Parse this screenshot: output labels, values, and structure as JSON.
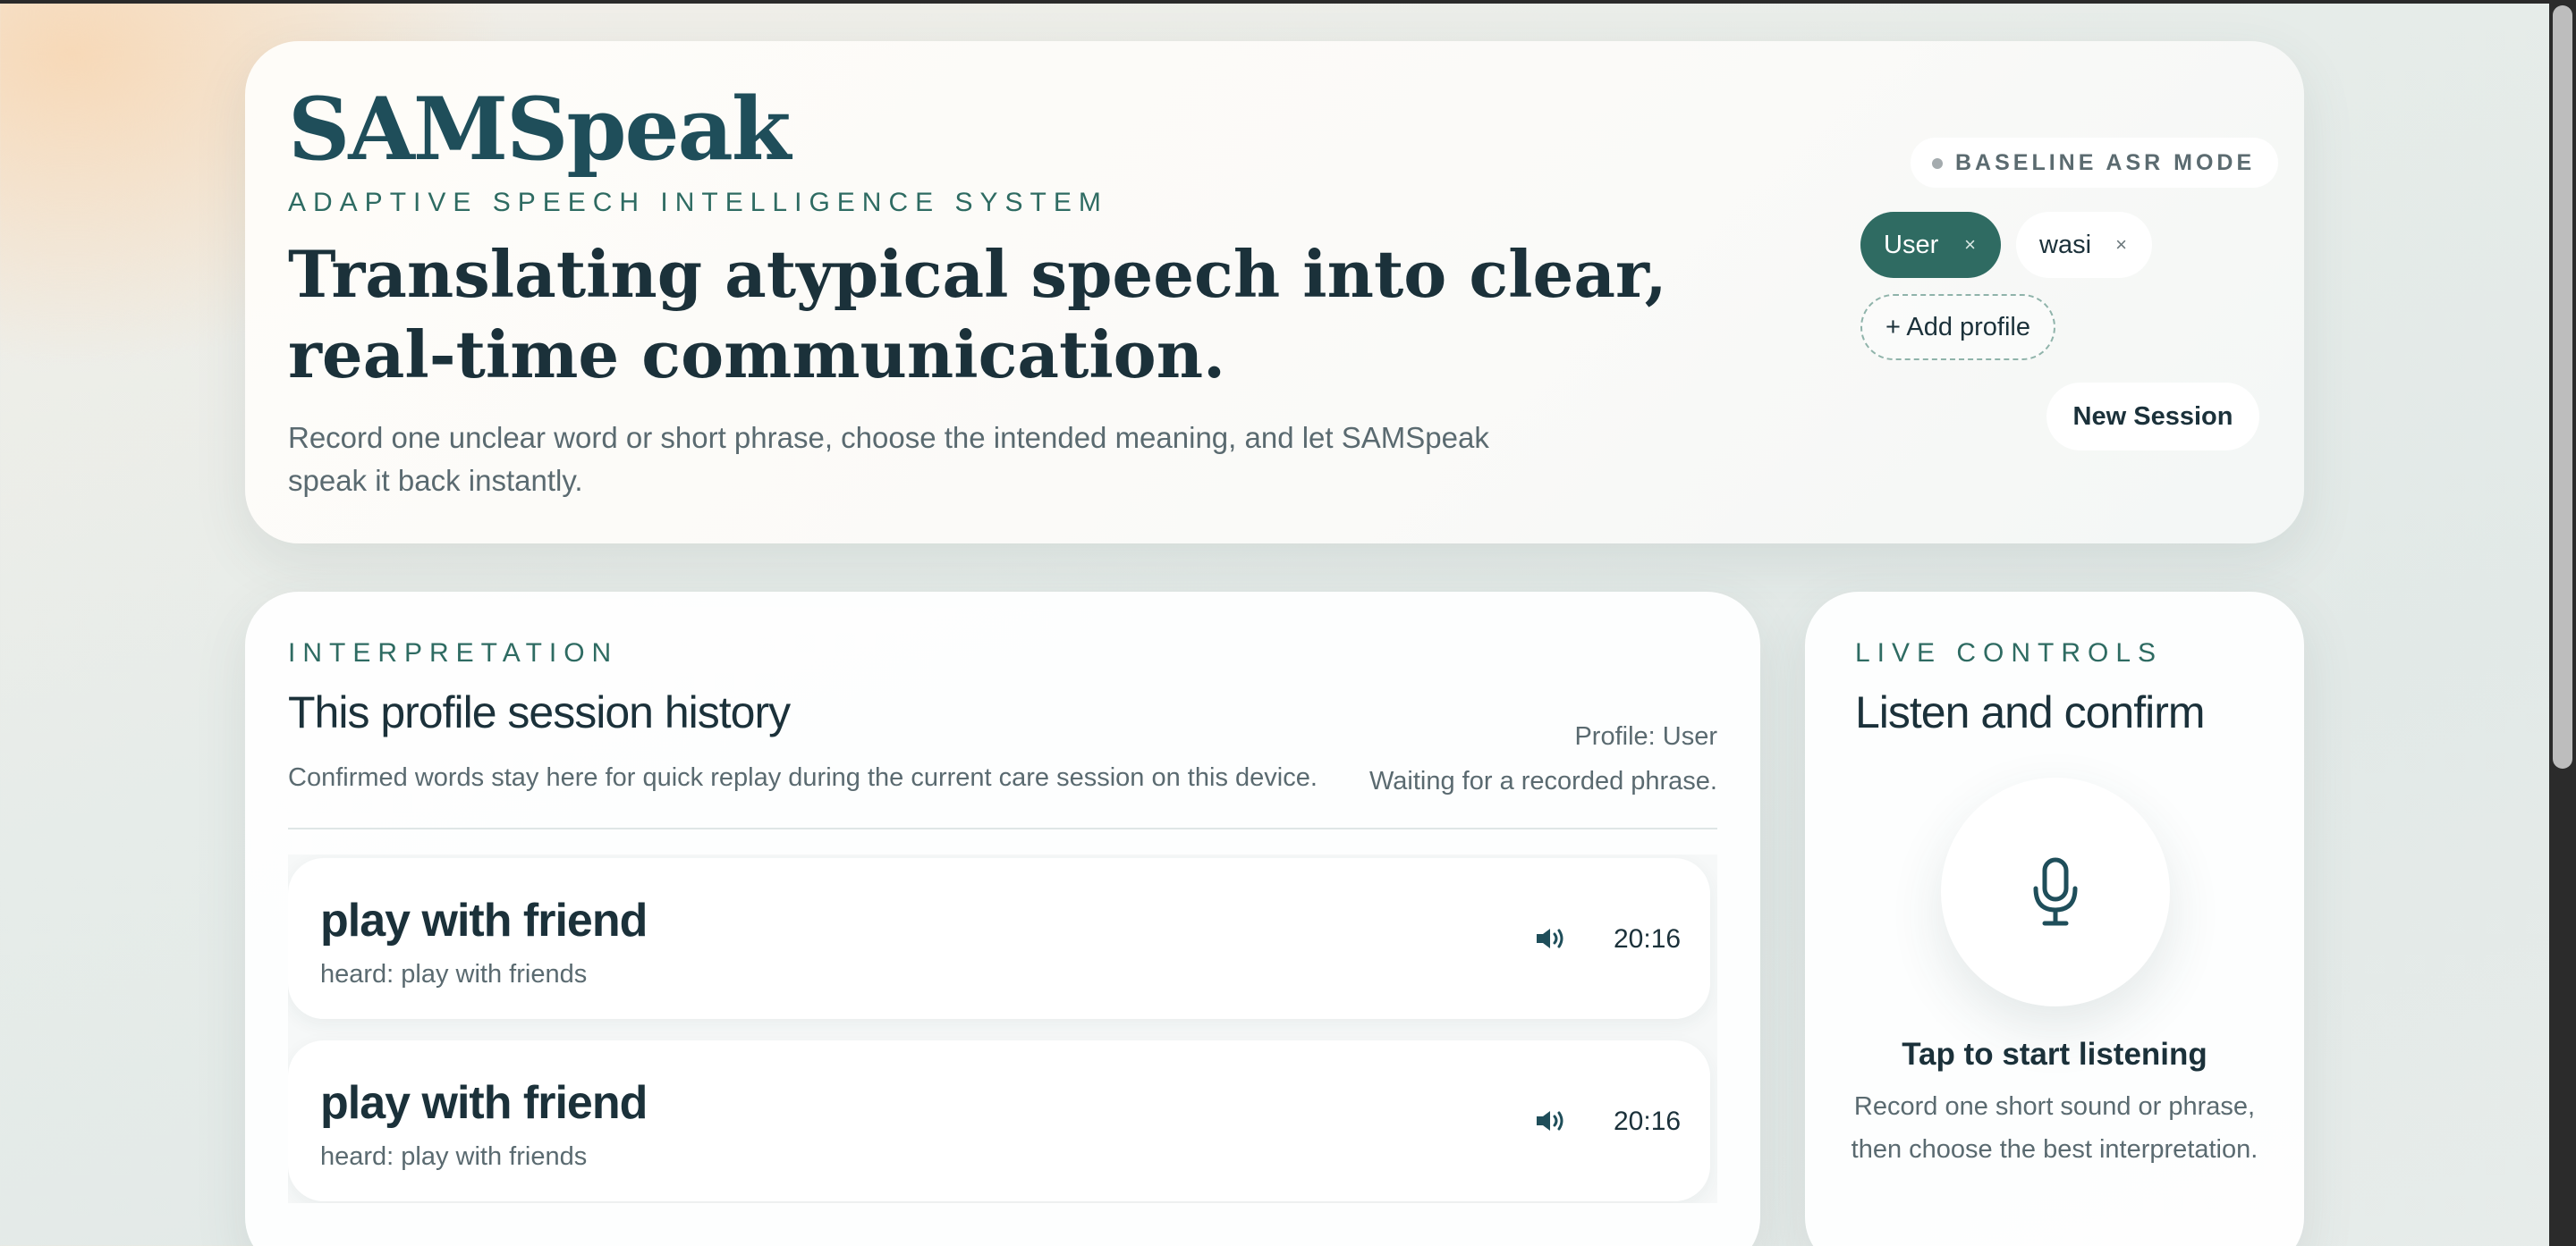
{
  "app": {
    "brand": "SAMSpeak",
    "tagline": "ADAPTIVE SPEECH INTELLIGENCE SYSTEM",
    "headline": "Translating atypical speech into clear, real-time communication.",
    "lede": "Record one unclear word or short phrase, choose the intended meaning, and let SAMSpeak speak it back instantly."
  },
  "header": {
    "mode_label": "BASELINE ASR MODE",
    "profiles": [
      {
        "label": "User",
        "active": true,
        "remove": "×"
      },
      {
        "label": "wasi",
        "active": false,
        "remove": "×"
      }
    ],
    "add_profile_label": "+ Add profile",
    "new_session_label": "New Session"
  },
  "interpretation": {
    "eyebrow": "INTERPRETATION",
    "title": "This profile session history",
    "description": "Confirmed words stay here for quick replay during the current care session on this device.",
    "profile_meta": "Profile: User",
    "status": "Waiting for a recorded phrase.",
    "history": [
      {
        "word": "play with friend",
        "heard": "heard: play with friends",
        "time": "20:16",
        "icon": "speaker-icon"
      },
      {
        "word": "play with friend",
        "heard": "heard: play with friends",
        "time": "20:16",
        "icon": "speaker-icon"
      }
    ]
  },
  "controls": {
    "eyebrow": "LIVE CONTROLS",
    "title": "Listen and confirm",
    "mic_icon": "microphone-icon",
    "tap_title": "Tap to start listening",
    "tap_description": "Record one short sound or phrase, then choose the best interpretation."
  },
  "colors": {
    "brand": "#1f4e5a",
    "accent": "#2f6b62",
    "text": "#1b313a",
    "muted": "#5a6a70"
  }
}
